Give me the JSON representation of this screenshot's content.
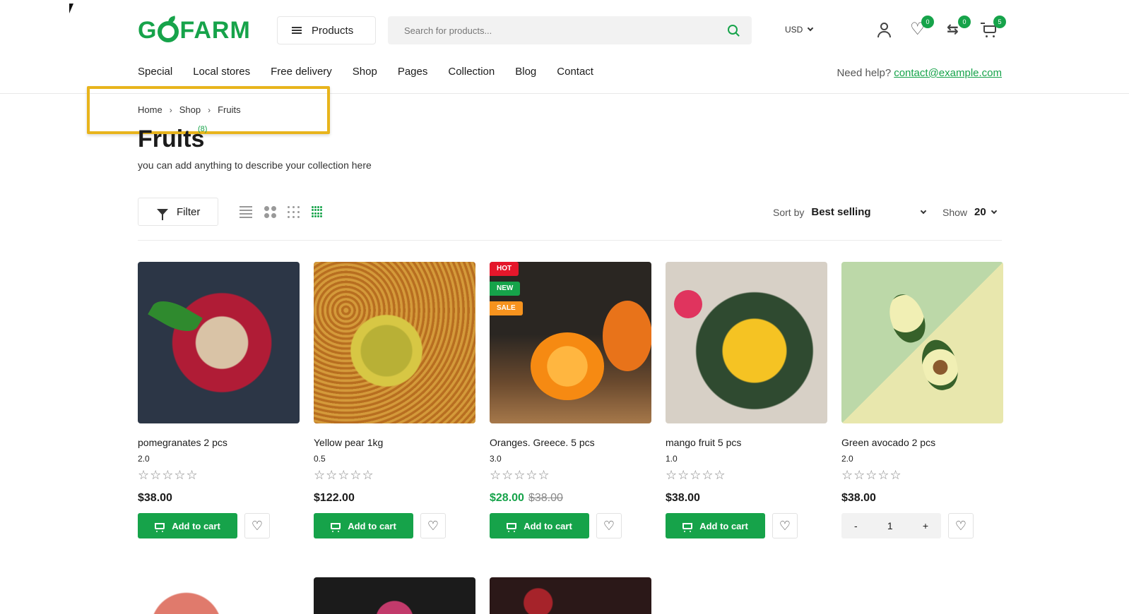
{
  "header": {
    "logo": "GOFARM",
    "products_label": "Products",
    "search_placeholder": "Search for products...",
    "currency": "USD",
    "wishlist_count": "0",
    "compare_count": "0",
    "cart_count": "5"
  },
  "nav": {
    "items": [
      "Special",
      "Local stores",
      "Free delivery",
      "Shop",
      "Pages",
      "Collection",
      "Blog",
      "Contact"
    ],
    "help_label": "Need help?",
    "help_email": "contact@example.com"
  },
  "breadcrumb": [
    "Home",
    "Shop",
    "Fruits"
  ],
  "collection": {
    "title": "Fruits",
    "count": "(8)",
    "description": "you can add anything to describe your collection here"
  },
  "toolbar": {
    "filter_label": "Filter",
    "sort_label": "Sort by",
    "sort_value": "Best selling",
    "show_label": "Show",
    "show_value": "20"
  },
  "products": [
    {
      "name": "pomegranates 2 pcs",
      "weight": "2.0",
      "price": "$38.00",
      "old_price": "",
      "button": "Add to cart"
    },
    {
      "name": "Yellow pear 1kg",
      "weight": "0.5",
      "price": "$122.00",
      "old_price": "",
      "button": "Add to cart"
    },
    {
      "name": "Oranges. Greece. 5 pcs",
      "weight": "3.0",
      "price": "$28.00",
      "old_price": "$38.00",
      "button": "Add to cart",
      "labels": [
        "HOT",
        "NEW",
        "SALE"
      ]
    },
    {
      "name": "mango fruit 5 pcs",
      "weight": "1.0",
      "price": "$38.00",
      "old_price": "",
      "button": "Add to cart"
    },
    {
      "name": "Green avocado 2 pcs",
      "weight": "2.0",
      "price": "$38.00",
      "old_price": "",
      "qty": "1",
      "minus": "-",
      "plus": "+"
    }
  ],
  "rating_stars": "☆☆☆☆☆",
  "colors": {
    "accent": "#16a34a",
    "hot": "#e4172b",
    "new": "#16a34a",
    "sale": "#f7931e",
    "highlight": "#e8b41c"
  }
}
